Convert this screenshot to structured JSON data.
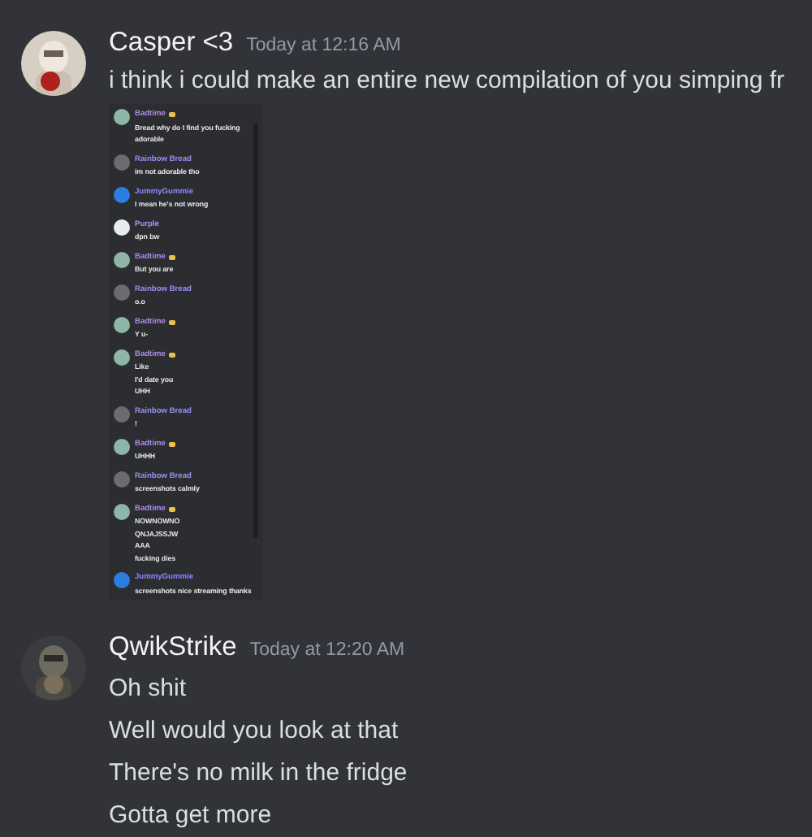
{
  "messages": [
    {
      "author": "Casper <3",
      "timestamp": "Today at 12:16 AM",
      "lines": [
        "i think i could make an entire new compilation of you simping fr"
      ],
      "attachment": {
        "kind": "screenshot",
        "messages": [
          {
            "author": "Badtime",
            "badge": true,
            "lines": [
              "Bread why do I find you fucking",
              "adorable"
            ]
          },
          {
            "author": "Rainbow Bread",
            "badge": false,
            "lines": [
              "im not adorable tho"
            ]
          },
          {
            "author": "JummyGummie",
            "badge": false,
            "lines": [
              "I mean he's not wrong"
            ]
          },
          {
            "author": "Purple",
            "badge": false,
            "lines": [
              "dpn bw"
            ]
          },
          {
            "author": "Badtime",
            "badge": true,
            "lines": [
              "But you are"
            ]
          },
          {
            "author": "Rainbow Bread",
            "badge": false,
            "lines": [
              "o.o"
            ]
          },
          {
            "author": "Badtime",
            "badge": true,
            "lines": [
              "Y u-"
            ]
          },
          {
            "author": "Badtime",
            "badge": true,
            "lines": [
              "Like",
              "I'd date you",
              "UHH"
            ]
          },
          {
            "author": "Rainbow Bread",
            "badge": false,
            "lines": [
              "!"
            ]
          },
          {
            "author": "Badtime",
            "badge": true,
            "lines": [
              "UHHH"
            ]
          },
          {
            "author": "Rainbow Bread",
            "badge": false,
            "lines": [
              "screenshots calmly"
            ]
          },
          {
            "author": "Badtime",
            "badge": true,
            "lines": [
              "NOWNOWNO",
              "QNJAJSSJW",
              "AAA",
              "fucking dies"
            ]
          },
          {
            "author": "JummyGummie",
            "badge": false,
            "lines": [
              "screenshots nice streaming thanks"
            ]
          }
        ]
      }
    },
    {
      "author": "QwikStrike",
      "timestamp": "Today at 12:20 AM",
      "lines": [
        "Oh shit",
        "Well would you look at that",
        "There's no milk in the fridge",
        "Gotta get more"
      ]
    }
  ]
}
